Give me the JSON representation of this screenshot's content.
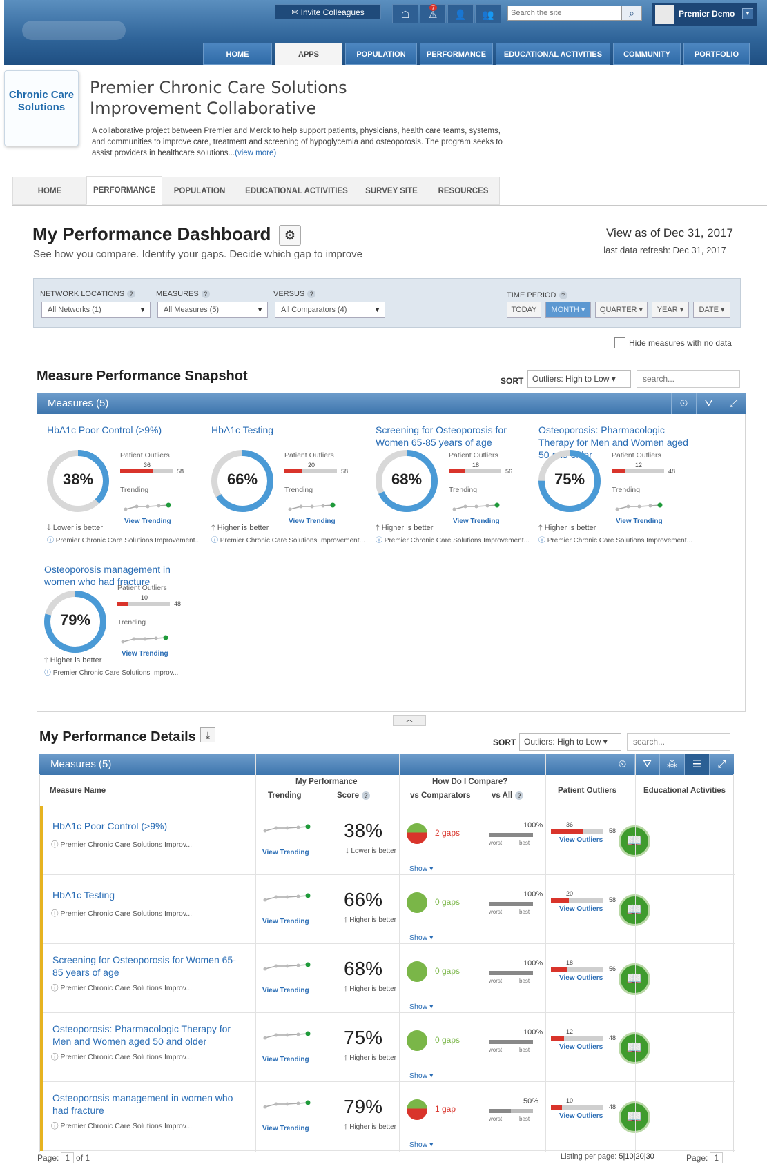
{
  "topbar": {
    "invite": "Invite Colleagues",
    "alert_count": "7",
    "search_placeholder": "Search the site",
    "user": "Premier Demo"
  },
  "main_nav": [
    {
      "label": "HOME"
    },
    {
      "label": "APPS"
    },
    {
      "label": "POPULATION"
    },
    {
      "label": "PERFORMANCE"
    },
    {
      "label": "EDUCATIONAL ACTIVITIES"
    },
    {
      "label": "COMMUNITY"
    },
    {
      "label": "PORTFOLIO"
    }
  ],
  "logo": {
    "text": "Chronic Care Solutions"
  },
  "header": {
    "title_line1": "Premier Chronic Care Solutions",
    "title_line2": "Improvement Collaborative",
    "description": "A collaborative project between Premier and Merck to help support patients, physicians, health care teams, systems, and communities to improve care, treatment and screening of hypoglycemia and osteoporosis. The program seeks to assist providers in healthcare solutions...",
    "view_more": "(view more)"
  },
  "sub_nav": [
    {
      "label": "HOME"
    },
    {
      "label": "PERFORMANCE"
    },
    {
      "label": "POPULATION"
    },
    {
      "label": "EDUCATIONAL ACTIVITIES"
    },
    {
      "label": "SURVEY SITE"
    },
    {
      "label": "RESOURCES"
    }
  ],
  "dashboard": {
    "title": "My Performance Dashboard",
    "subtitle": "See how you compare. Identify your gaps. Decide which gap to improve",
    "view_as": "View as of Dec 31, 2017",
    "refresh": "last data refresh: Dec 31, 2017"
  },
  "filters": {
    "network_label": "NETWORK LOCATIONS",
    "network_value": "All Networks (1)",
    "measures_label": "MEASURES",
    "measures_value": "All Measures (5)",
    "versus_label": "VERSUS",
    "versus_value": "All Comparators (4)",
    "time_label": "TIME PERIOD",
    "time_buttons": [
      "TODAY",
      "MONTH",
      "QUARTER",
      "YEAR",
      "DATE"
    ],
    "time_selected": "MONTH",
    "hide_label": "Hide measures with no data"
  },
  "snapshot": {
    "title": "Measure Performance Snapshot",
    "sort_label": "SORT",
    "sort_value": "Outliers: High to Low",
    "search_placeholder": "search...",
    "header": "Measures (5)"
  },
  "labels": {
    "patient_outliers": "Patient Outliers",
    "trending": "Trending",
    "view_trending": "View Trending",
    "view_outliers": "View Outliers",
    "show": "Show",
    "worst": "worst",
    "best": "best"
  },
  "measures": [
    {
      "title": "HbA1c Poor Control (>9%)",
      "score": "38%",
      "pct": 38,
      "direction": "Lower is better",
      "dir_arrow": "down",
      "outliers": "36",
      "total": "58",
      "source": "Premier Chronic Care Solutions Improvement...",
      "source_short": "Premier Chronic Care Solutions Improv...",
      "gaps": "2 gaps",
      "gap_color": "#d9342b",
      "vs_all": "100%",
      "vs_all_frac": 1.0
    },
    {
      "title": "HbA1c Testing",
      "score": "66%",
      "pct": 66,
      "direction": "Higher is better",
      "dir_arrow": "up",
      "outliers": "20",
      "total": "58",
      "source": "Premier Chronic Care Solutions Improvement...",
      "source_short": "Premier Chronic Care Solutions Improv...",
      "gaps": "0 gaps",
      "gap_color": "#7ab648",
      "vs_all": "100%",
      "vs_all_frac": 1.0
    },
    {
      "title": "Screening for Osteoporosis for Women 65-85 years of age",
      "score": "68%",
      "pct": 68,
      "direction": "Higher is better",
      "dir_arrow": "up",
      "outliers": "18",
      "total": "56",
      "source": "Premier Chronic Care Solutions Improvement...",
      "source_short": "Premier Chronic Care Solutions Improv...",
      "gaps": "0 gaps",
      "gap_color": "#7ab648",
      "vs_all": "100%",
      "vs_all_frac": 1.0
    },
    {
      "title": "Osteoporosis: Pharmacologic Therapy for Men and Women aged 50 and older",
      "score": "75%",
      "pct": 75,
      "direction": "Higher is better",
      "dir_arrow": "up",
      "outliers": "12",
      "total": "48",
      "source": "Premier Chronic Care Solutions Improvement...",
      "source_short": "Premier Chronic Care Solutions Improv...",
      "gaps": "0 gaps",
      "gap_color": "#7ab648",
      "vs_all": "100%",
      "vs_all_frac": 1.0
    },
    {
      "title": "Osteoporosis management in women who had fracture",
      "score": "79%",
      "pct": 79,
      "direction": "Higher is better",
      "dir_arrow": "up",
      "outliers": "10",
      "total": "48",
      "source": "Premier Chronic Care Solutions Improv...",
      "source_short": "Premier Chronic Care Solutions Improv...",
      "gaps": "1 gap",
      "gap_color": "#d9342b",
      "vs_all": "50%",
      "vs_all_frac": 0.5
    }
  ],
  "details": {
    "title": "My Performance Details",
    "sort_label": "SORT",
    "sort_value": "Outliers: High to Low",
    "search_placeholder": "search...",
    "header": "Measures (5)",
    "col_measure": "Measure Name",
    "col_my_perf": "My Performance",
    "col_trending": "Trending",
    "col_score": "Score",
    "col_compare": "How Do I Compare?",
    "col_vs_comp": "vs Comparators",
    "col_vs_all": "vs All",
    "col_outliers": "Patient Outliers",
    "col_edu": "Educational Activities"
  },
  "footer": {
    "page_label": "Page:",
    "page_num": "1",
    "of": "of 1",
    "listing": "Listing per page:",
    "listing_opts": "5|10|20|30",
    "page_label2": "Page:",
    "page_num2": "1"
  },
  "colors": {
    "accent": "#3d75ad",
    "ring": "#4a9ad6",
    "bad": "#d9342b",
    "good": "#7ab648",
    "stripe": "#e6b320"
  }
}
